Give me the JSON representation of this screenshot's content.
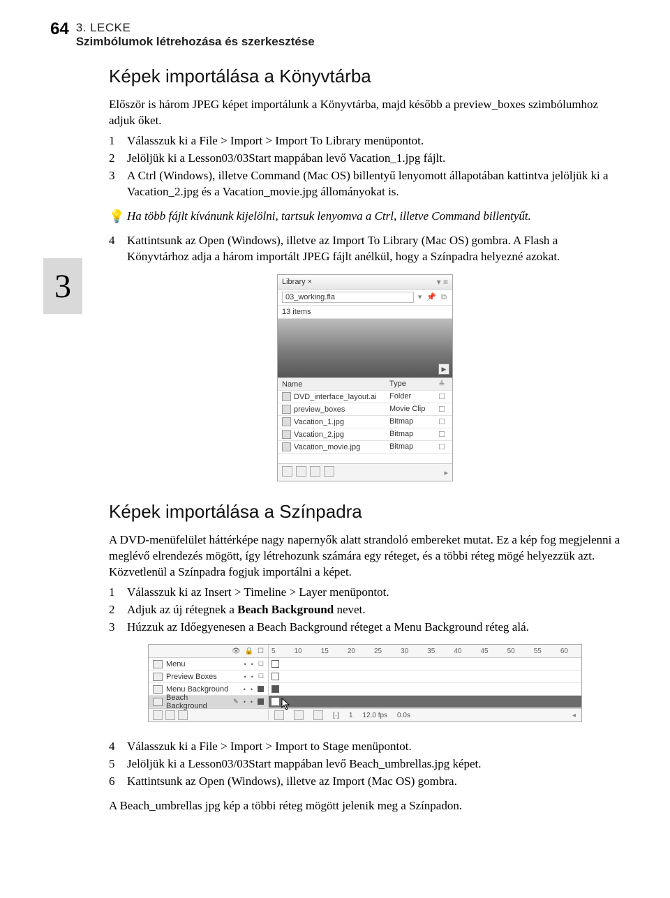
{
  "header": {
    "page_number": "64",
    "lesson_num": "3. LECKE",
    "lesson_title": "Szimbólumok létrehozása és szerkesztése"
  },
  "side_marker": "3",
  "section1": {
    "title": "Képek importálása a Könyvtárba",
    "intro": "Először is három JPEG képet importálunk a Könyvtárba, majd később a preview_boxes szimbólumhoz adjuk őket.",
    "steps": {
      "1": "Válasszuk ki a File > Import > Import To Library menüpontot.",
      "2": "Jelöljük ki a Lesson03/03Start mappában levő Vacation_1.jpg fájlt.",
      "3": "A Ctrl (Windows), illetve Command (Mac OS) billentyű lenyomott állapotában kattintva jelöljük ki a Vacation_2.jpg és a Vacation_movie.jpg állományokat is.",
      "tip": "Ha több fájlt kívánunk kijelölni, tartsuk lenyomva a Ctrl, illetve Command billentyűt.",
      "4": "Kattintsunk az Open (Windows), illetve az Import To Library (Mac OS) gombra. A Flash a Könyvtárhoz adja a három importált JPEG fájlt anélkül, hogy a Színpadra helyezné azokat."
    }
  },
  "library_panel": {
    "tab": "Library ×",
    "file": "03_working.fla",
    "count": "13 items",
    "head_name": "Name",
    "head_type": "Type",
    "items": [
      {
        "name": "DVD_interface_layout.ai",
        "type": "Folder"
      },
      {
        "name": "preview_boxes",
        "type": "Movie Clip"
      },
      {
        "name": "Vacation_1.jpg",
        "type": "Bitmap"
      },
      {
        "name": "Vacation_2.jpg",
        "type": "Bitmap"
      },
      {
        "name": "Vacation_movie.jpg",
        "type": "Bitmap"
      }
    ]
  },
  "section2": {
    "title": "Képek importálása a Színpadra",
    "intro": "A DVD-menüfelület háttérképe nagy napernyők alatt strandoló embereket mutat. Ez a kép fog megjelenni a meglévő elrendezés mögött, így létrehozunk számára egy réteget, és a többi réteg mögé helyezzük azt. Közvetlenül a Színpadra fogjuk importálni a képet.",
    "steps_a": {
      "1": "Válasszuk ki az Insert > Timeline > Layer menüpontot.",
      "2_pre": "Adjuk az új rétegnek a ",
      "2_bold": "Beach Background",
      "2_post": " nevet.",
      "3": "Húzzuk az Időegyenesen a Beach Background réteget a Menu Background réteg alá."
    },
    "steps_b": {
      "4": "Válasszuk ki a File > Import > Import to Stage menüpontot.",
      "5": "Jelöljük ki a Lesson03/03Start mappában levő Beach_umbrellas.jpg képet.",
      "6": "Kattintsunk az Open (Windows), illetve az Import (Mac OS) gombra."
    },
    "closing": "A Beach_umbrellas jpg kép a többi réteg mögött jelenik meg a Színpadon."
  },
  "timeline": {
    "ruler": [
      "5",
      "10",
      "15",
      "20",
      "25",
      "30",
      "35",
      "40",
      "45",
      "50",
      "55",
      "60"
    ],
    "layers": [
      "Menu",
      "Preview Boxes",
      "Menu Background",
      "Beach Background"
    ],
    "footer": {
      "frame": "1",
      "fps": "12.0 fps",
      "time": "0.0s"
    }
  }
}
